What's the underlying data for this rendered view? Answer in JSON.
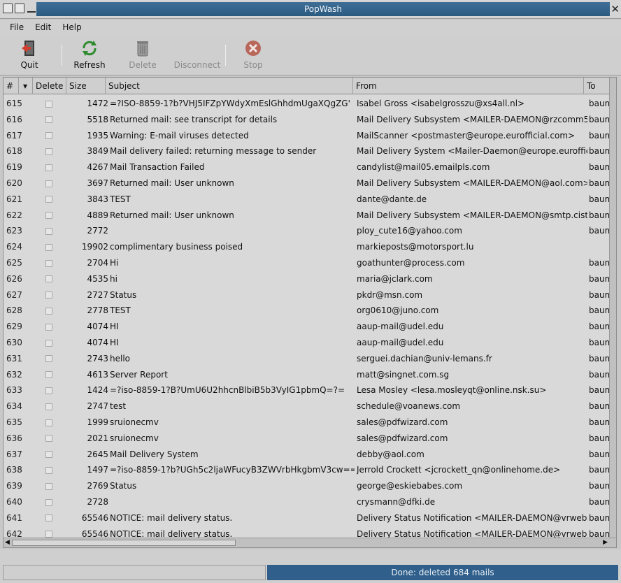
{
  "window": {
    "title": "PopWash"
  },
  "menu": [
    {
      "label": "File"
    },
    {
      "label": "Edit"
    },
    {
      "label": "Help"
    }
  ],
  "toolbar": {
    "quit": "Quit",
    "refresh": "Refresh",
    "delete": "Delete",
    "disconnect": "Disconnect",
    "stop": "Stop"
  },
  "columns": {
    "num": "#",
    "sort_glyph": "▾",
    "delete": "Delete",
    "size": "Size",
    "subject": "Subject",
    "from": "From",
    "to": "To"
  },
  "rows": [
    {
      "num": "615",
      "size": "1472",
      "subject": "=?ISO-8859-1?b?VHJ5IFZpYWdyXmEslGhhdmUgaXQgZG'",
      "from": "Isabel Gross <isabelgrosszu@xs4all.nl>",
      "to": "baum@"
    },
    {
      "num": "616",
      "size": "5518",
      "subject": "Returned mail: see transcript for details",
      "from": "Mail Delivery Subsystem <MAILER-DAEMON@rzcomm5",
      "to": "baum <"
    },
    {
      "num": "617",
      "size": "1935",
      "subject": "Warning: E-mail viruses detected",
      "from": "MailScanner <postmaster@europe.eurofficial.com>",
      "to": "baum@"
    },
    {
      "num": "618",
      "size": "3849",
      "subject": "Mail delivery failed: returning message to sender",
      "from": "Mail Delivery System <Mailer-Daemon@europe.eurofficl",
      "to": "baum@"
    },
    {
      "num": "619",
      "size": "4267",
      "subject": "Mail Transaction Failed",
      "from": "candylist@mail05.emailpls.com",
      "to": "baum@"
    },
    {
      "num": "620",
      "size": "3697",
      "subject": "Returned mail: User unknown",
      "from": "Mail Delivery Subsystem <MAILER-DAEMON@aol.com>",
      "to": "baum <"
    },
    {
      "num": "621",
      "size": "3843",
      "subject": "TEST",
      "from": "dante@dante.de",
      "to": "baum@"
    },
    {
      "num": "622",
      "size": "4889",
      "subject": "Returned mail: User unknown",
      "from": "Mail Delivery Subsystem <MAILER-DAEMON@smtp.cist",
      "to": "baum@"
    },
    {
      "num": "623",
      "size": "2772",
      "subject": "",
      "from": "ploy_cute16@yahoo.com",
      "to": "baum@"
    },
    {
      "num": "624",
      "size": "19902",
      "subject": "complimentary business poised",
      "from": "markieposts@motorsport.lu",
      "to": ""
    },
    {
      "num": "625",
      "size": "2704",
      "subject": "Hi",
      "from": "goathunter@process.com",
      "to": "baum@"
    },
    {
      "num": "626",
      "size": "4535",
      "subject": "hi",
      "from": "maria@jclark.com",
      "to": "baum@"
    },
    {
      "num": "627",
      "size": "2727",
      "subject": "Status",
      "from": "pkdr@msn.com",
      "to": "baum@"
    },
    {
      "num": "628",
      "size": "2778",
      "subject": "TEST",
      "from": "org0610@juno.com",
      "to": "baum@"
    },
    {
      "num": "629",
      "size": "4074",
      "subject": "HI",
      "from": "aaup-mail@udel.edu",
      "to": "baum@"
    },
    {
      "num": "630",
      "size": "4074",
      "subject": "HI",
      "from": "aaup-mail@udel.edu",
      "to": "baum@"
    },
    {
      "num": "631",
      "size": "2743",
      "subject": "hello",
      "from": "serguei.dachian@univ-lemans.fr",
      "to": "baum@"
    },
    {
      "num": "632",
      "size": "4613",
      "subject": "Server Report",
      "from": "matt@singnet.com.sg",
      "to": "baum@"
    },
    {
      "num": "633",
      "size": "1424",
      "subject": "=?iso-8859-1?B?UmU6U2hhcnBlbiB5b3VyIG1pbmQ=?=",
      "from": "Lesa Mosley <lesa.mosleyqt@online.nsk.su>",
      "to": "baum@"
    },
    {
      "num": "634",
      "size": "2747",
      "subject": "test",
      "from": "schedule@voanews.com",
      "to": "baum@"
    },
    {
      "num": "635",
      "size": "1999",
      "subject": "sruionecmv",
      "from": "sales@pdfwizard.com",
      "to": "baum@"
    },
    {
      "num": "636",
      "size": "2021",
      "subject": "sruionecmv",
      "from": "sales@pdfwizard.com",
      "to": "baum@"
    },
    {
      "num": "637",
      "size": "2645",
      "subject": "Mail Delivery System",
      "from": "debby@aol.com",
      "to": "baum@"
    },
    {
      "num": "638",
      "size": "1497",
      "subject": "=?iso-8859-1?b?UGh5c2ljaWFucyB3ZWVrbHkgbmV3cw==",
      "from": "Jerrold Crockett <jcrockett_qn@onlinehome.de>",
      "to": "baum@"
    },
    {
      "num": "639",
      "size": "2769",
      "subject": "Status",
      "from": "george@eskiebabes.com",
      "to": "baum@"
    },
    {
      "num": "640",
      "size": "2728",
      "subject": "",
      "from": "crysmann@dfki.de",
      "to": "baum@"
    },
    {
      "num": "641",
      "size": "65546",
      "subject": "NOTICE: mail delivery status.",
      "from": "Delivery Status Notification <MAILER-DAEMON@vrweb.",
      "to": "baum@"
    },
    {
      "num": "642",
      "size": "65546",
      "subject": "NOTICE: mail delivery status.",
      "from": "Delivery Status Notification <MAILER-DAEMON@vrweb.",
      "to": "baum@"
    }
  ],
  "status": {
    "message": "Done: deleted 684 mails"
  }
}
